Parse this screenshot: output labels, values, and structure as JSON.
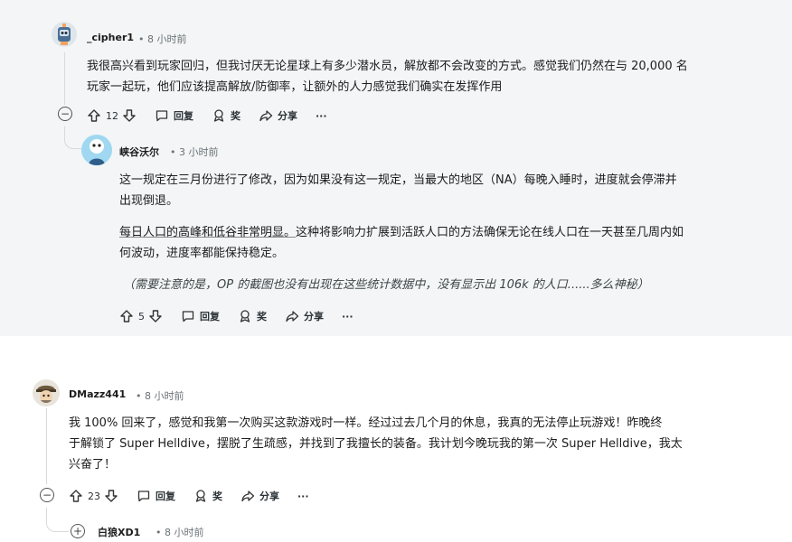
{
  "comments": [
    {
      "author": "_cipher1",
      "time": "• 8 小时前",
      "lines": [
        "我很高兴看到玩家回归，但我讨厌无论星球上有多少潜水员，解放都不会改变的方式。感觉我们仍然在与 20,000 名",
        "玩家一起玩，他们应该提高解放/防御率，让额外的人力感觉我们确实在发挥作用"
      ],
      "actions": {
        "votes": "12",
        "reply": "回复",
        "award": "奖",
        "share": "分享",
        "more": "···"
      },
      "collapse": "−"
    },
    {
      "author": "峡谷沃尔",
      "time": "• 3 小时前",
      "para1": [
        "这一规定在三月份进行了修改，因为如果没有这一规定，当最大的地区（NA）每晚入睡时，进度就会停滞并",
        "出现倒退。"
      ],
      "para2_underlined": "每日人口的高峰和低谷非常明显。",
      "para2_rest": "这种将影响力扩展到活跃人口的方法确保无论在线人口在一天甚至几周内如",
      "para2_line2": "何波动，进度率都能保持稳定。",
      "note": "（需要注意的是，OP 的截图也没有出现在这些统计数据中，没有显示出 106k 的人口......多么神秘）",
      "actions": {
        "votes": "5",
        "reply": "回复",
        "award": "奖",
        "share": "分享",
        "more": "···"
      }
    },
    {
      "author": "DMazz441",
      "time": "• 8 小时前",
      "lines": [
        "我 100% 回来了，感觉和我第一次购买这款游戏时一样。经过过去几个月的休息，我真的无法停止玩游戏！昨晚终",
        "于解锁了 Super Helldive，摆脱了生疏感，并找到了我擅长的装备。我计划今晚玩我的第一次 Super Helldive，我太",
        "兴奋了！"
      ],
      "actions": {
        "votes": "23",
        "reply": "回复",
        "award": "奖",
        "share": "分享",
        "more": "···"
      },
      "collapse": "−"
    },
    {
      "author": "白狼XD1",
      "time": "• 8 小时前",
      "expand": "+"
    }
  ],
  "colors": {
    "card_bg": "#f3f5f6",
    "text": "#1c1c1c",
    "muted": "#6b7378",
    "line": "#d6dadc"
  }
}
